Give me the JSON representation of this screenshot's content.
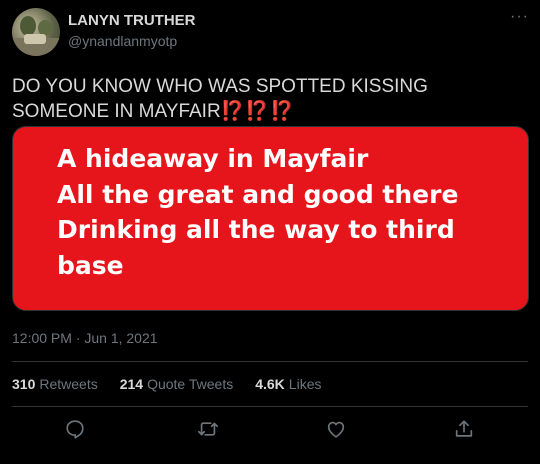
{
  "user": {
    "display_name": "LANYN TRUTHER",
    "handle": "@ynandlanmyotp",
    "avatar_icon": "landscape-photo-avatar"
  },
  "more_label": "···",
  "tweet": {
    "text": "DO YOU KNOW WHO WAS SPOTTED KISSING SOMEONE IN MAYFAIR",
    "emphasis": "⁉️⁉️⁉️"
  },
  "media": {
    "background_color": "#e6151b",
    "lines": [
      "A hideaway in Mayfair",
      "All the great and good there",
      "Drinking all the way to third",
      "base"
    ]
  },
  "timestamp": "12:00 PM · Jun 1, 2021",
  "stats": {
    "retweets_count": "310",
    "retweets_label": "Retweets",
    "quotes_count": "214",
    "quotes_label": "Quote Tweets",
    "likes_count": "4.6K",
    "likes_label": "Likes"
  },
  "actions": [
    "reply-icon",
    "retweet-icon",
    "like-icon",
    "share-icon"
  ],
  "colors": {
    "background": "#000000",
    "text": "#d9d9d9",
    "secondary_text": "#6e767d",
    "divider": "#2f3336",
    "accent_red": "#e0303a"
  }
}
